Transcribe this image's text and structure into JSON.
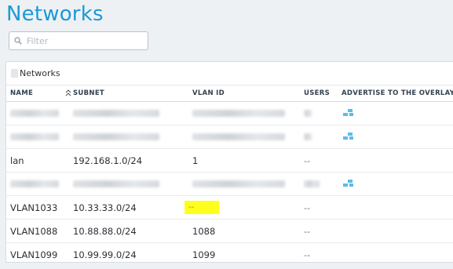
{
  "page": {
    "title": "Networks"
  },
  "filter": {
    "placeholder": "Filter",
    "value": ""
  },
  "panel": {
    "title": "Networks"
  },
  "table": {
    "columns": [
      "NAME",
      "SUBNET",
      "VLAN ID",
      "USERS",
      "ADVERTISE TO THE OVERLAY"
    ],
    "sorted_column": "NAME",
    "rows": [
      {
        "name": "",
        "subnet": "",
        "vlan_id": "",
        "users": "",
        "advertise": true,
        "redacted": true
      },
      {
        "name": "",
        "subnet": "",
        "vlan_id": "",
        "users": "",
        "advertise": true,
        "redacted": true
      },
      {
        "name": "lan",
        "subnet": "192.168.1.0/24",
        "vlan_id": "1",
        "users": "--",
        "advertise": false,
        "redacted": false
      },
      {
        "name": "",
        "subnet": "",
        "vlan_id": "",
        "users": "",
        "advertise": true,
        "redacted": true
      },
      {
        "name": "VLAN1033",
        "subnet": "10.33.33.0/24",
        "vlan_id": "--",
        "users": "--",
        "advertise": false,
        "redacted": false,
        "vlan_highlighted": true
      },
      {
        "name": "VLAN1088",
        "subnet": "10.88.88.0/24",
        "vlan_id": "1088",
        "users": "--",
        "advertise": false,
        "redacted": false
      },
      {
        "name": "VLAN1099",
        "subnet": "10.99.99.0/24",
        "vlan_id": "1099",
        "users": "--",
        "advertise": false,
        "redacted": false
      }
    ]
  },
  "icons": {
    "filter": "search-icon",
    "panel": "document-icon",
    "sort": "sort-ascending-icon",
    "advertise": "overlay-icon"
  },
  "colors": {
    "title": "#1a9ad6",
    "highlight": "#ffff1e",
    "overlay_icon": "#5bbce8"
  }
}
